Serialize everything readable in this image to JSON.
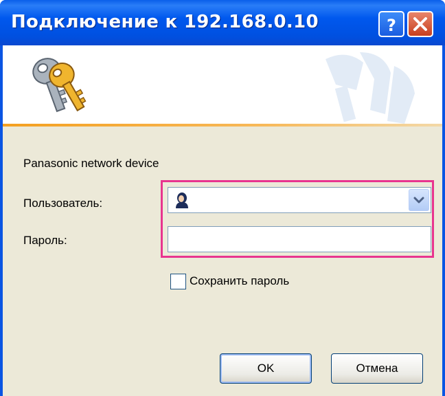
{
  "window": {
    "title": "Подключение к 192.168.0.10",
    "help_icon": "question-mark-icon",
    "close_icon": "close-x-icon"
  },
  "banner": {
    "icon": "keys-icon"
  },
  "form": {
    "realm": "Panasonic network device",
    "user_label": "Пользователь:",
    "user_value": "",
    "user_icon": "user-avatar-icon",
    "password_label": "Пароль:",
    "password_value": "",
    "remember_label": "Сохранить пароль",
    "remember_checked": false
  },
  "buttons": {
    "ok": "OK",
    "cancel": "Отмена"
  },
  "colors": {
    "titlebar": "#0058ee",
    "highlight": "#e8348f",
    "dialog_bg": "#ece9d8"
  }
}
